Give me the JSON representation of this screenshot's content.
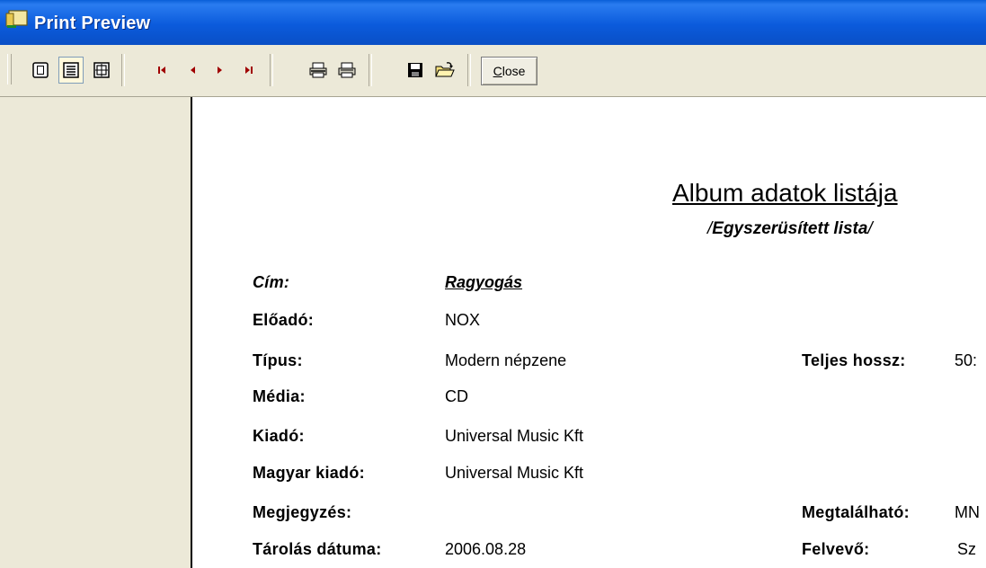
{
  "window": {
    "title": "Print Preview"
  },
  "toolbar": {
    "buttons": [
      {
        "name": "one-page-icon"
      },
      {
        "name": "two-pages-icon"
      },
      {
        "name": "zoom-icon"
      },
      {
        "name": "first-page-icon"
      },
      {
        "name": "previous-page-icon"
      },
      {
        "name": "next-page-icon"
      },
      {
        "name": "last-page-icon"
      },
      {
        "name": "print-setup-icon"
      },
      {
        "name": "print-icon"
      },
      {
        "name": "save-icon"
      },
      {
        "name": "open-icon"
      }
    ],
    "close_label_underlined": "C",
    "close_label_rest": "lose"
  },
  "report": {
    "title": "Album adatok listája",
    "subtitle_slash_open": "/",
    "subtitle_text": "Egyszerüsített lista",
    "subtitle_slash_close": "/",
    "fields": {
      "cim_label": "Cím:",
      "cim_value": "Ragyogás",
      "eloado_label": "Előadó:",
      "eloado_value": "NOX",
      "tipus_label": "Típus:",
      "tipus_value": "Modern népzene",
      "media_label": "Média:",
      "media_value": "CD",
      "kiado_label": "Kiadó:",
      "kiado_value": "Universal Music Kft",
      "magyar_kiado_label": "Magyar kiadó:",
      "magyar_kiado_value": "Universal Music Kft",
      "megjegyzes_label": "Megjegyzés:",
      "tarolas_label": "Tárolás dátuma:",
      "tarolas_value": "2006.08.28",
      "teljes_hossz_label": "Teljes hossz:",
      "teljes_hossz_value": "50:",
      "megtalalhato_label": "Megtalálható:",
      "megtalalhato_value": "MN",
      "felvevo_label": "Felvevő:",
      "felvevo_value": "Sz"
    }
  }
}
